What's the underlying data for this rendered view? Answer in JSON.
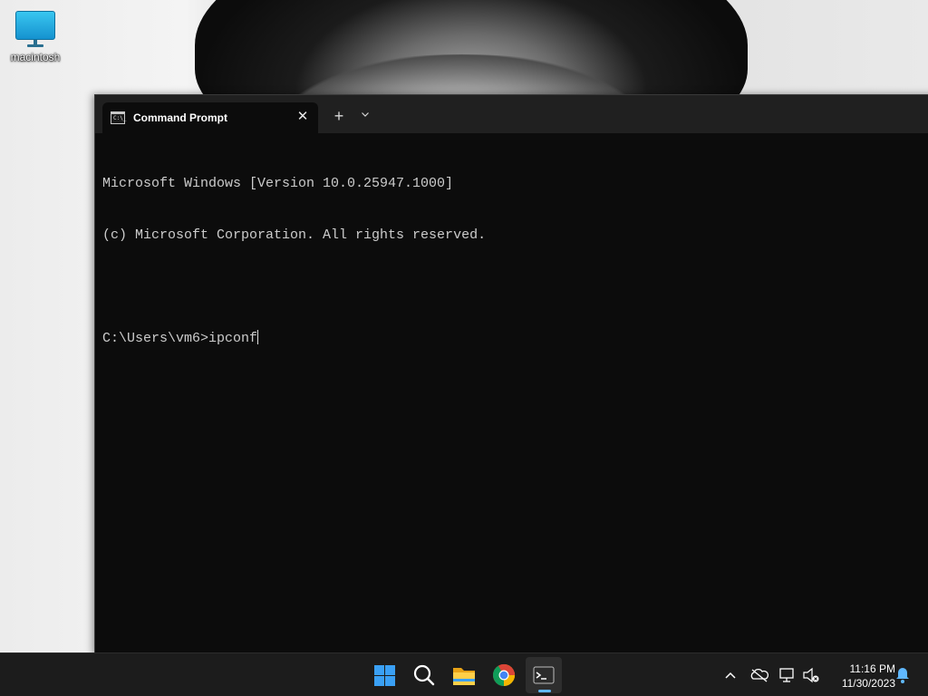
{
  "desktop": {
    "icons": [
      {
        "label": "macintosh",
        "icon": "monitor-icon"
      }
    ]
  },
  "window": {
    "tab": {
      "title": "Command Prompt",
      "icon": "cmd-icon",
      "close_glyph": "✕"
    },
    "new_tab_glyph": "+",
    "dropdown_glyph": "⌄",
    "minimize_glyph": "—"
  },
  "console": {
    "lines": [
      "Microsoft Windows [Version 10.0.25947.1000]",
      "(c) Microsoft Corporation. All rights reserved.",
      "",
      "C:\\Users\\vm6>ipconf"
    ]
  },
  "taskbar": {
    "apps": [
      {
        "name": "Start",
        "icon": "windows-start-icon"
      },
      {
        "name": "Search",
        "icon": "search-icon"
      },
      {
        "name": "File Explorer",
        "icon": "folder-icon"
      },
      {
        "name": "Google Chrome",
        "icon": "chrome-icon"
      },
      {
        "name": "Terminal",
        "icon": "terminal-icon",
        "active": true
      }
    ],
    "tray": {
      "time": "11:16 PM",
      "date": "11/30/2023"
    }
  },
  "colors": {
    "accent": "#3aa0f5",
    "terminal_bg": "#0c0c0c",
    "terminal_text": "#cccccc",
    "taskbar_bg": "#1c1c1c"
  }
}
